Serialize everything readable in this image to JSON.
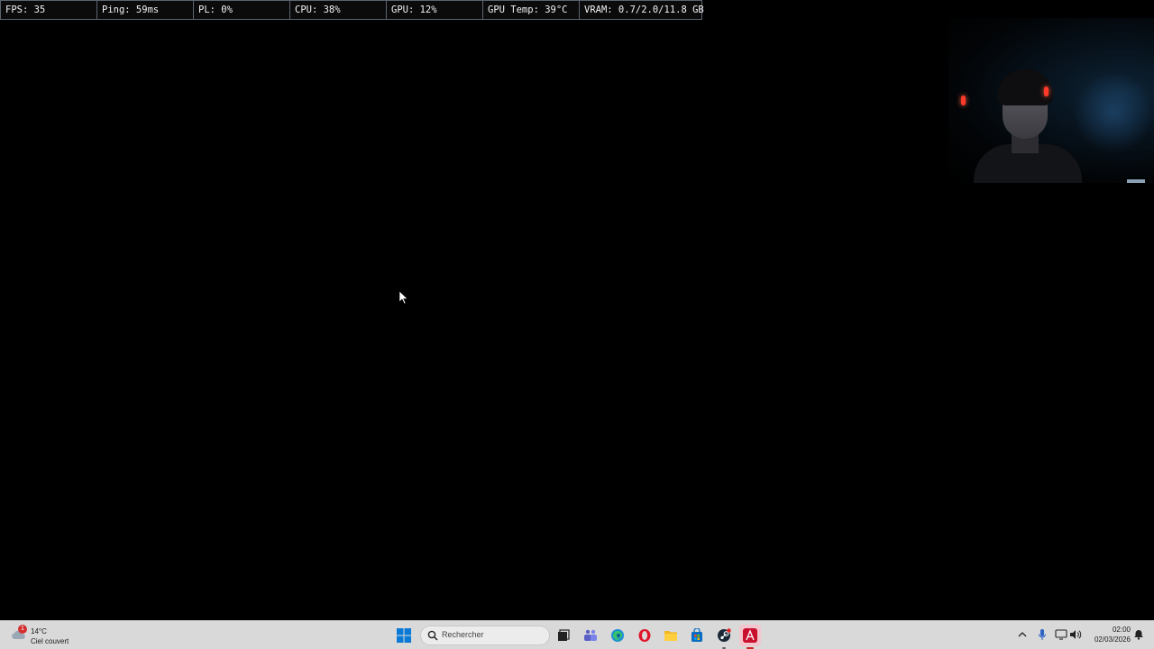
{
  "stats": {
    "fps": "FPS: 35",
    "ping": "Ping: 59ms",
    "pl": "PL: 0%",
    "cpu": "CPU: 38%",
    "gpu": "GPU: 12%",
    "gpu_temp": "GPU Temp: 39°C",
    "vram": "VRAM: 0.7/2.0/11.8 GB"
  },
  "weather": {
    "temperature": "14°C",
    "description": "Ciel couvert",
    "badge": "1",
    "icon": "cloud-icon"
  },
  "taskbar": {
    "search_placeholder": "Rechercher",
    "apps": [
      "start-icon",
      "task-view-icon",
      "teams-icon",
      "edge-icon",
      "opera-icon",
      "file-explorer-icon",
      "store-icon",
      "steam-icon",
      "acrobat-icon"
    ],
    "active_app": "acrobat-icon"
  },
  "clock": {
    "time": "02:00",
    "date": "02/03/2026"
  },
  "colors": {
    "overlay_border": "#5b6470",
    "taskbar_bg": "#d9d9d9",
    "start_blue": "#0a7ad6",
    "opera_red": "#e0152b",
    "acrobat_red": "#c8102e"
  }
}
